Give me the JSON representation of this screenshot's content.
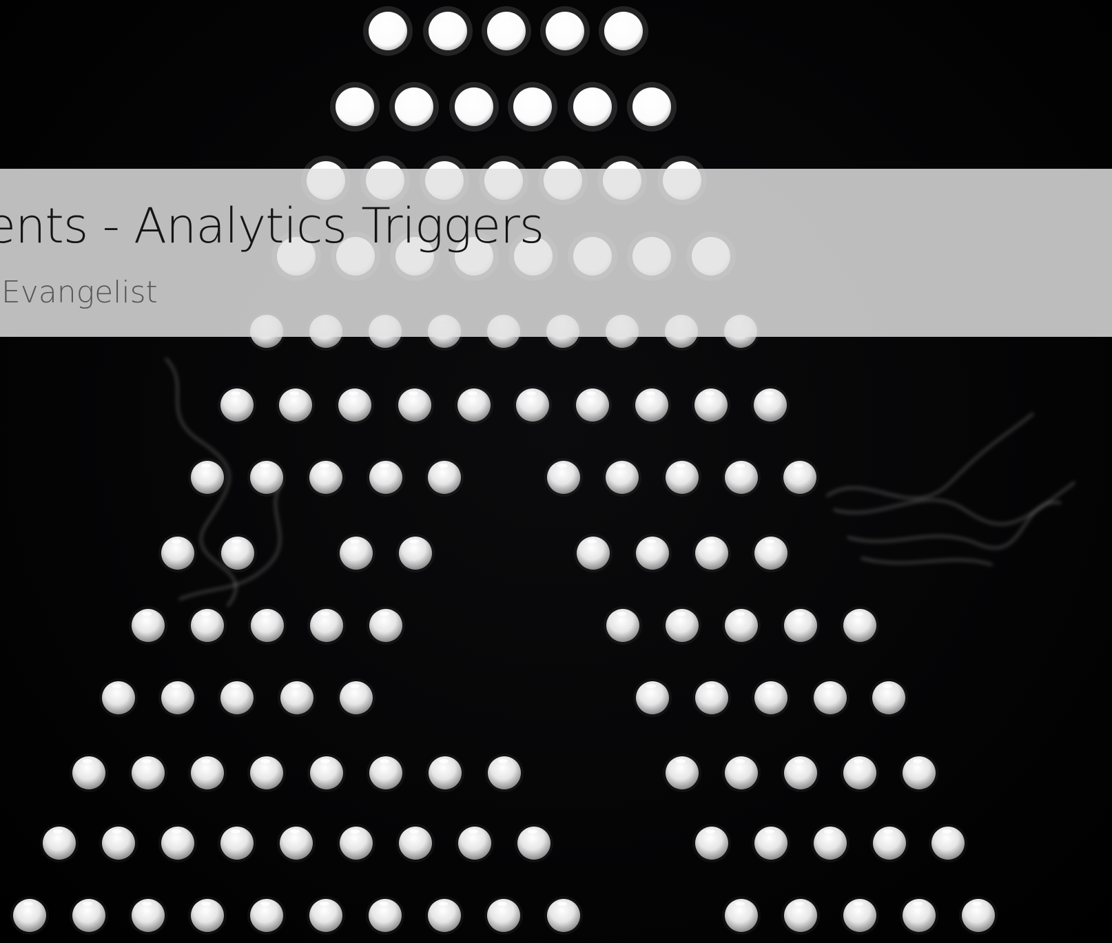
{
  "slide": {
    "title": "ents - Analytics Triggers",
    "subtitle": "Evangelist"
  },
  "background": {
    "image": "black background with rows of glowing white balls and wisps of smoke",
    "color": "#000000",
    "banner_color": "#e1e1e1"
  }
}
